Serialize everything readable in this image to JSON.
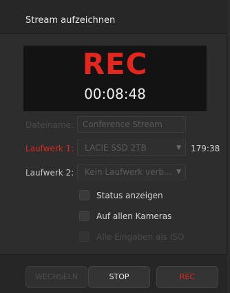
{
  "header": {
    "title": "Stream aufzeichnen"
  },
  "recorder": {
    "status": "REC",
    "timecode": "00:08:48"
  },
  "filename": {
    "label": "Dateiname:",
    "value": "Conference Stream"
  },
  "drive1": {
    "label": "Laufwerk 1:",
    "value": "LACIE SSD 2TB",
    "free": "179:38"
  },
  "drive2": {
    "label": "Laufwerk 2:",
    "value": "Kein Laufwerk verb..."
  },
  "options": {
    "show_status": "Status anzeigen",
    "all_cameras": "Auf allen Kameras",
    "all_inputs_iso": "Alle Eingaben als ISO"
  },
  "buttons": {
    "switch": "WECHSELN",
    "stop": "STOP",
    "rec": "REC"
  },
  "colors": {
    "accent_red": "#e4261f",
    "panel": "#2d2d2d"
  }
}
